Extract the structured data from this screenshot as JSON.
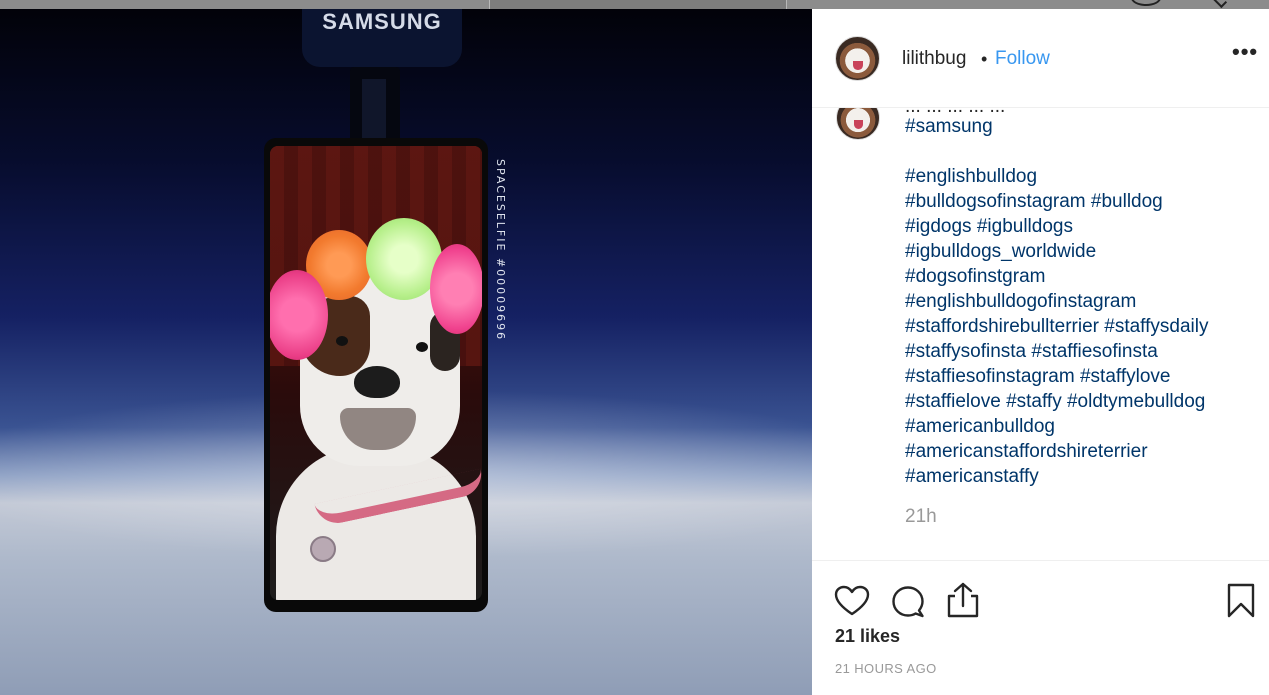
{
  "photo": {
    "brand_logo": "SAMSUNG",
    "vertical_text": "SPACESELFIE #00009696"
  },
  "post": {
    "username": "lilithbug",
    "separator": "•",
    "follow_label": "Follow",
    "more_label": "•••",
    "caption_cut_line": "... ... ... ... ...",
    "hashtag_lines": [
      [
        "#samsung"
      ],
      [],
      [
        "#englishbulldog"
      ],
      [
        "#bulldogsofinstagram",
        "#bulldog"
      ],
      [
        "#igdogs",
        "#igbulldogs"
      ],
      [
        "#igbulldogs_worldwide"
      ],
      [
        "#dogsofinstgram"
      ],
      [
        "#englishbulldogofinstagram"
      ],
      [
        "#staffordshirebullterrier",
        "#staffysdaily"
      ],
      [
        "#staffysofinsta",
        "#staffiesofinsta"
      ],
      [
        "#staffiesofinstagram",
        "#staffylove"
      ],
      [
        "#staffielove",
        "#staffy",
        "#oldtymebulldog"
      ],
      [
        "#americanbulldog"
      ],
      [
        "#americanstaffordshireterrier"
      ],
      [
        "#americanstaffy"
      ]
    ],
    "relative_time": "21h",
    "likes_text": "21 likes",
    "posted_ago": "21 HOURS AGO"
  },
  "icons": {
    "like": "heart-icon",
    "comment": "comment-icon",
    "share": "share-icon",
    "save": "bookmark-icon"
  },
  "colors": {
    "link": "#3897f0",
    "hashtag": "#003569",
    "muted": "#999999"
  }
}
